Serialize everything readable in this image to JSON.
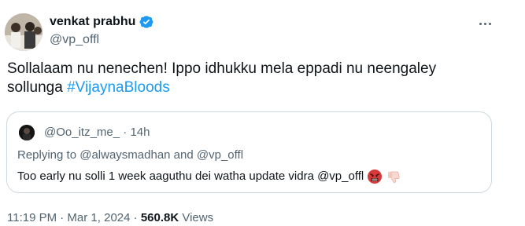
{
  "author": {
    "display_name": "venkat prabhu",
    "handle": "@vp_offl"
  },
  "tweet": {
    "text": "Sollalaam nu nenechen! Ippo idhukku mela eppadi nu neengaley sollunga ",
    "hashtag": "#VijaynaBloods"
  },
  "quoted": {
    "handle": "@Oo_itz_me_",
    "separator": " · ",
    "time": "14h",
    "replying_prefix": "Replying to ",
    "reply_user_1": "@alwaysmadhan",
    "reply_and": " and ",
    "reply_user_2": "@vp_offl",
    "text": "Too early nu solli 1 week aaguthu dei watha update vidra @vp_offl"
  },
  "meta": {
    "time": "11:19 PM · Mar 1, 2024 · ",
    "views_count": "560.8K",
    "views_label": " Views"
  },
  "icons": {
    "verified": "verified-badge-icon",
    "more": "more-horizontal-icon",
    "emoji1": "enraged-face-icon",
    "emoji2": "thumbs-down-icon"
  },
  "colors": {
    "link": "#1d9bf0",
    "secondary": "#536471",
    "border": "#cfd9de"
  }
}
